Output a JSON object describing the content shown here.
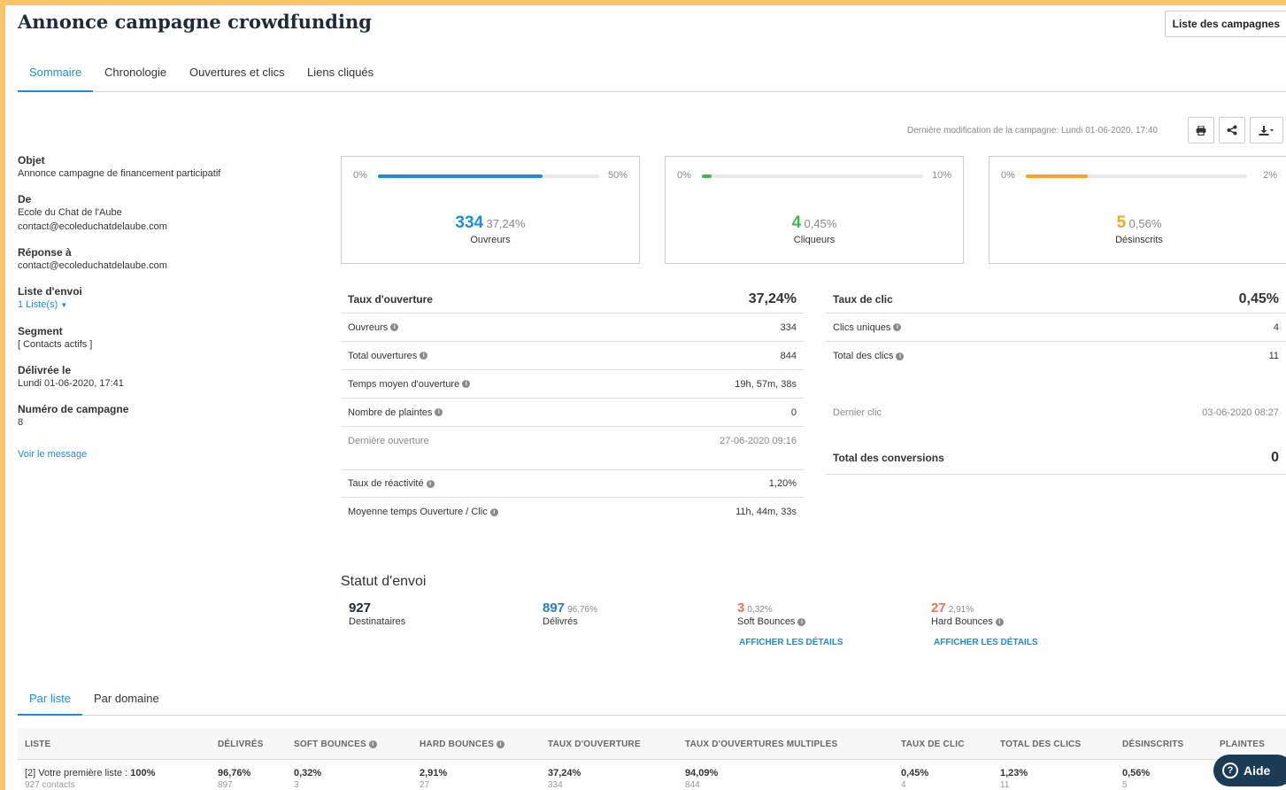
{
  "header": {
    "title": "Annonce campagne crowdfunding",
    "campaigns_button": "Liste des campagnes"
  },
  "tabs": [
    "Sommaire",
    "Chronologie",
    "Ouvertures et clics",
    "Liens cliqués"
  ],
  "last_modified": "Dernière modification de la campagne:  Lundi 01-06-2020, 17:40",
  "toolbar_icons": [
    "print-icon",
    "share-icon",
    "download-icon"
  ],
  "details": {
    "objet": {
      "label": "Objet",
      "value": "Annonce campagne de financement participatif"
    },
    "de": {
      "label": "De",
      "name": "Ecole du Chat de l'Aube",
      "email": "contact@ecoleduchatdelaube.com"
    },
    "reponse": {
      "label": "Réponse à",
      "value": "contact@ecoleduchatdelaube.com"
    },
    "liste": {
      "label": "Liste d'envoi",
      "value": "1 Liste(s)"
    },
    "segment": {
      "label": "Segment",
      "value": "[ Contacts actifs ]"
    },
    "delivree": {
      "label": "Délivrée le",
      "value": "Lundi 01-06-2020, 17:41"
    },
    "numero": {
      "label": "Numéro de campagne",
      "value": "8"
    },
    "voir": "Voir le message"
  },
  "cards": [
    {
      "min": "0%",
      "max": "50%",
      "fill": 0.745,
      "color": "#1a8fd8",
      "num": "334",
      "pct": "37,24%",
      "caption": "Ouvreurs"
    },
    {
      "min": "0%",
      "max": "10%",
      "fill": 0.045,
      "color": "#3cb950",
      "num": "4",
      "pct": "0,45%",
      "caption": "Cliqueurs"
    },
    {
      "min": "0%",
      "max": "2%",
      "fill": 0.28,
      "color": "#f5a623",
      "num": "5",
      "pct": "0,56%",
      "caption": "Désinscrits"
    }
  ],
  "open_stats": {
    "header_label": "Taux d'ouverture",
    "header_value": "37,24%",
    "rows": [
      {
        "label": "Ouvreurs",
        "value": "334"
      },
      {
        "label": "Total ouvertures",
        "value": "844"
      },
      {
        "label": "Temps moyen d'ouverture",
        "value": "19h, 57m, 38s"
      },
      {
        "label": "Nombre de plaintes",
        "value": "0"
      },
      {
        "label": "Dernière ouverture",
        "value": "27-06-2020 09:16"
      },
      {
        "label": "Taux de réactivité",
        "value": "1,20%"
      },
      {
        "label": "Moyenne temps Ouverture / Clic",
        "value": "11h, 44m, 33s"
      }
    ]
  },
  "click_stats": {
    "header_label": "Taux de clic",
    "header_value": "0,45%",
    "rows": [
      {
        "label": "Clics uniques",
        "value": "4"
      },
      {
        "label": "Total des clics",
        "value": "11"
      },
      {
        "label": "Dernier clic",
        "value": "03-06-2020 08:27"
      }
    ],
    "conversions_label": "Total des conversions",
    "conversions_value": "0"
  },
  "statut": {
    "title": "Statut d'envoi",
    "destinataires": {
      "num": "927",
      "label": "Destinataires"
    },
    "delivres": {
      "num": "897",
      "pct": "96,76%",
      "label": "Délivrés"
    },
    "soft": {
      "num": "3",
      "pct": "0,32%",
      "label": "Soft Bounces",
      "details": "AFFICHER LES DÉTAILS"
    },
    "hard": {
      "num": "27",
      "pct": "2,91%",
      "label": "Hard Bounces",
      "details": "AFFICHER LES DÉTAILS"
    }
  },
  "subtabs": [
    "Par liste",
    "Par domaine"
  ],
  "table": {
    "headers": [
      "LISTE",
      "DÉLIVRÉS",
      "SOFT BOUNCES",
      "HARD BOUNCES",
      "TAUX D'OUVERTURE",
      "TAUX D'OUVERTURES MULTIPLES",
      "TAUX DE CLIC",
      "TOTAL DES CLICS",
      "DÉSINSCRITS",
      "PLAINTES"
    ],
    "row": {
      "list_name": "[2] Votre première liste : ",
      "list_pct": "100%",
      "contacts": "927 contacts",
      "cells": [
        {
          "main": "96,76%",
          "sub": "897"
        },
        {
          "main": "0,32%",
          "sub": "3"
        },
        {
          "main": "2,91%",
          "sub": "27"
        },
        {
          "main": "37,24%",
          "sub": "334"
        },
        {
          "main": "94,09%",
          "sub": "844"
        },
        {
          "main": "0,45%",
          "sub": "4"
        },
        {
          "main": "1,23%",
          "sub": "11"
        },
        {
          "main": "0,56%",
          "sub": "5"
        }
      ]
    }
  },
  "help": {
    "label": "Aide"
  },
  "colors": {
    "accent": "#1a8fd8",
    "green": "#3cb950",
    "orange": "#f5a623",
    "red": "#e8735a",
    "frame": "#f9c46b",
    "help_bg": "#1c3b55"
  }
}
